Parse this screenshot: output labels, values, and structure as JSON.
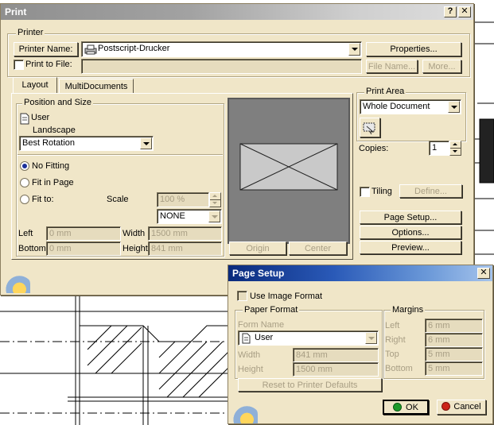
{
  "print_dialog": {
    "title": "Print",
    "help_glyph": "?",
    "close_glyph": "✕",
    "printer_group": "Printer",
    "printer_name_button": "Printer Name:",
    "printer_name_value": "Postscript-Drucker",
    "properties_button": "Properties...",
    "print_to_file_label": "Print to File:",
    "file_name_button": "File Name...",
    "more_button": "More...",
    "tabs": [
      {
        "label": "Layout"
      },
      {
        "label": "MultiDocuments"
      }
    ],
    "position_group": "Position and Size",
    "orientation_user": "User",
    "orientation_landscape": "Landscape",
    "rotation_value": "Best Rotation",
    "no_fitting": "No Fitting",
    "fit_in_page": "Fit in Page",
    "fit_to": "Fit to:",
    "scale_label": "Scale",
    "scale_value": "100 %",
    "fit_select_value": "NONE",
    "left_label": "Left",
    "left_value": "0 mm",
    "bottom_label": "Bottom",
    "bottom_value": "0 mm",
    "width_label": "Width",
    "width_value": "1500 mm",
    "height_label": "Height",
    "height_value": "841 mm",
    "origin_button": "Origin",
    "center_button": "Center",
    "print_area_group": "Print Area",
    "print_area_value": "Whole Document",
    "copies_label": "Copies:",
    "copies_value": "1",
    "tiling_label": "Tiling",
    "define_button": "Define...",
    "page_setup_button": "Page Setup...",
    "options_button": "Options...",
    "preview_button": "Preview..."
  },
  "page_setup_dialog": {
    "title": "Page Setup",
    "close_glyph": "✕",
    "use_image_format": "Use Image Format",
    "paper_format_group": "Paper Format",
    "form_name_label": "Form Name",
    "form_name_value": "User",
    "width_label": "Width",
    "width_value": "841 mm",
    "height_label": "Height",
    "height_value": "1500 mm",
    "reset_button": "Reset to Printer Defaults",
    "margins_group": "Margins",
    "margins": [
      {
        "label": "Left",
        "value": "6 mm"
      },
      {
        "label": "Right",
        "value": "6 mm"
      },
      {
        "label": "Top",
        "value": "5 mm"
      },
      {
        "label": "Bottom",
        "value": "5 mm"
      }
    ],
    "ok_button": "OK",
    "cancel_button": "Cancel"
  },
  "colors": {
    "dialog_bg": "#f0e6c8",
    "active_title": "#0a2a7c",
    "inactive_title": "#8f8f8f",
    "disabled_text": "#a89e84"
  }
}
